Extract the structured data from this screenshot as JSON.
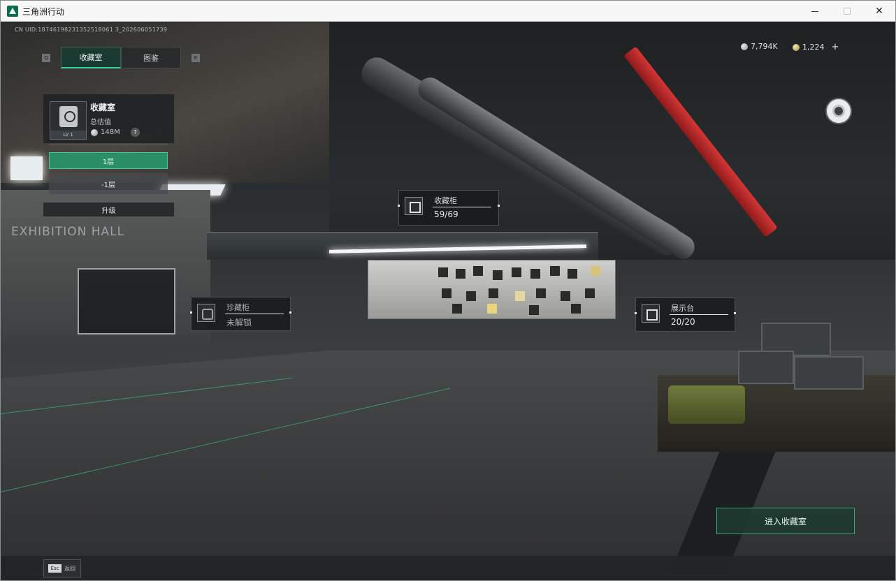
{
  "window": {
    "title": "三角洲行动"
  },
  "uid_text": "CN UID:18746198231352518061 3_202606051739",
  "tabs": [
    {
      "label": "收藏室",
      "active": true
    },
    {
      "label": "图鉴",
      "active": false
    }
  ],
  "key_hints": {
    "prev": "Q",
    "next": "E"
  },
  "collection_panel": {
    "title": "收藏室",
    "subtitle": "总估值",
    "value": "148M",
    "level": "LV 1",
    "help": "?"
  },
  "floors": [
    {
      "label": "1层",
      "active": true
    },
    {
      "label": "-1层",
      "active": false
    }
  ],
  "upgrade_label": "升级",
  "currency": {
    "silver": "7,794K",
    "gold": "1,224",
    "plus": "+"
  },
  "scene_sign": "EXHIBITION HALL",
  "markers": {
    "cabinet": {
      "title": "收藏柜",
      "value": "59/69"
    },
    "treasure": {
      "title": "珍藏柜",
      "value": "未解锁"
    },
    "display": {
      "title": "展示台",
      "value": "20/20"
    }
  },
  "enter_button": "进入收藏室",
  "esc": {
    "key": "Esc",
    "label": "返回"
  },
  "colors": {
    "accent_green": "#2a8f66",
    "highlight_green": "#3fd19a",
    "red_pipe": "#d33636"
  },
  "icons": {
    "app": "app-logo-icon",
    "disc": "disc-icon",
    "silver_coin": "silver-coin-icon",
    "gold_coin": "gold-coin-icon"
  }
}
